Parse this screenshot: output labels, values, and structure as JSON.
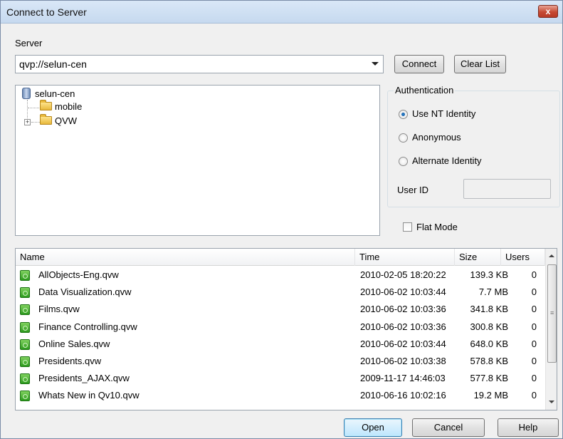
{
  "window": {
    "title": "Connect to Server",
    "close_label": "x"
  },
  "server": {
    "label": "Server",
    "value": "qvp://selun-cen",
    "connect_label": "Connect",
    "clear_label": "Clear List"
  },
  "tree": {
    "root": "selun-cen",
    "children": [
      "mobile",
      "QVW"
    ],
    "expander_symbol": "+"
  },
  "auth": {
    "legend": "Authentication",
    "options": [
      "Use NT Identity",
      "Anonymous",
      "Alternate Identity"
    ],
    "selected": "Use NT Identity",
    "user_id_label": "User ID",
    "user_id_value": ""
  },
  "flat_mode": {
    "label": "Flat Mode",
    "checked": false
  },
  "files": {
    "columns": [
      "Name",
      "Time",
      "Size",
      "Users"
    ],
    "rows": [
      [
        "AllObjects-Eng.qvw",
        "2010-02-05 18:20:22",
        "139.3 KB",
        "0"
      ],
      [
        "Data Visualization.qvw",
        "2010-06-02 10:03:44",
        "7.7 MB",
        "0"
      ],
      [
        "Films.qvw",
        "2010-06-02 10:03:36",
        "341.8 KB",
        "0"
      ],
      [
        "Finance Controlling.qvw",
        "2010-06-02 10:03:36",
        "300.8 KB",
        "0"
      ],
      [
        "Online Sales.qvw",
        "2010-06-02 10:03:44",
        "648.0 KB",
        "0"
      ],
      [
        "Presidents.qvw",
        "2010-06-02 10:03:38",
        "578.8 KB",
        "0"
      ],
      [
        "Presidents_AJAX.qvw",
        "2009-11-17 14:46:03",
        "577.8 KB",
        "0"
      ],
      [
        "Whats New in Qv10.qvw",
        "2010-06-16 10:02:16",
        "19.2 MB",
        "0"
      ]
    ]
  },
  "buttons": {
    "open": "Open",
    "cancel": "Cancel",
    "help": "Help"
  },
  "icons": {
    "file": "qvw-document-icon",
    "folder": "folder-icon",
    "server": "server-icon"
  }
}
